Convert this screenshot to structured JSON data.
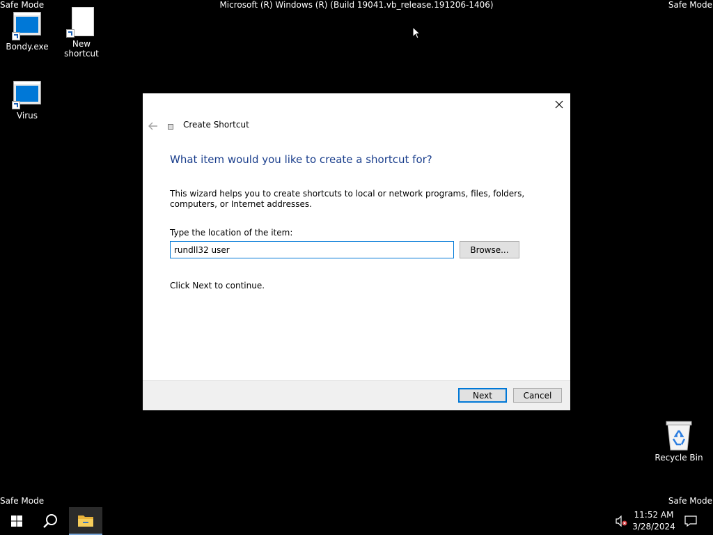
{
  "safe_mode_label": "Safe Mode",
  "build_string": "Microsoft (R) Windows (R) (Build 19041.vb_release.191206-1406)",
  "desktop": {
    "icons": [
      {
        "label": "Bondy.exe",
        "icon": "exe-app-icon"
      },
      {
        "label": "New shortcut",
        "icon": "blank-file-icon"
      },
      {
        "label": "Virus",
        "icon": "exe-app-icon"
      },
      {
        "label": "Recycle Bin",
        "icon": "recycle-bin-icon"
      }
    ]
  },
  "dialog": {
    "wizard_title": "Create Shortcut",
    "heading": "What item would you like to create a shortcut for?",
    "description": "This wizard helps you to create shortcuts to local or network programs, files, folders, computers, or Internet addresses.",
    "location_label": "Type the location of the item:",
    "location_value": "rundll32 user",
    "browse_label": "Browse...",
    "continue_text": "Click Next to continue.",
    "next_label": "Next",
    "cancel_label": "Cancel",
    "colors": {
      "heading": "#1a3e8c",
      "accent": "#0078d7"
    }
  },
  "taskbar": {
    "time": "11:52 AM",
    "date": "3/28/2024",
    "icons": [
      "windows-start-icon",
      "search-icon",
      "file-explorer-icon",
      "volume-muted-icon",
      "notifications-icon"
    ]
  }
}
